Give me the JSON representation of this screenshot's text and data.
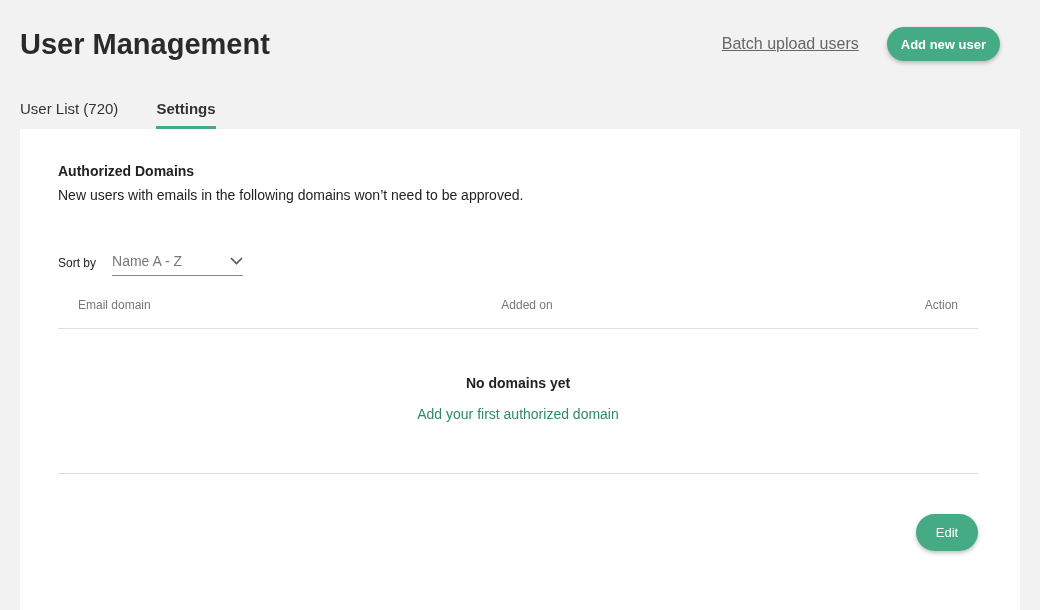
{
  "header": {
    "title": "User Management",
    "batch_link": "Batch upload users",
    "add_button": "Add new user"
  },
  "tabs": [
    {
      "label": "User List (720)",
      "selected": false
    },
    {
      "label": "Settings",
      "selected": true
    }
  ],
  "section": {
    "title": "Authorized Domains",
    "description": "New users with emails in the following domains won’t need to be approved."
  },
  "sort": {
    "label": "Sort by",
    "value": "Name A - Z"
  },
  "table": {
    "columns": [
      "Email domain",
      "Added on",
      "Action"
    ]
  },
  "empty_state": {
    "title": "No domains yet",
    "link": "Add your first authorized domain"
  },
  "edit_button": "Edit"
}
